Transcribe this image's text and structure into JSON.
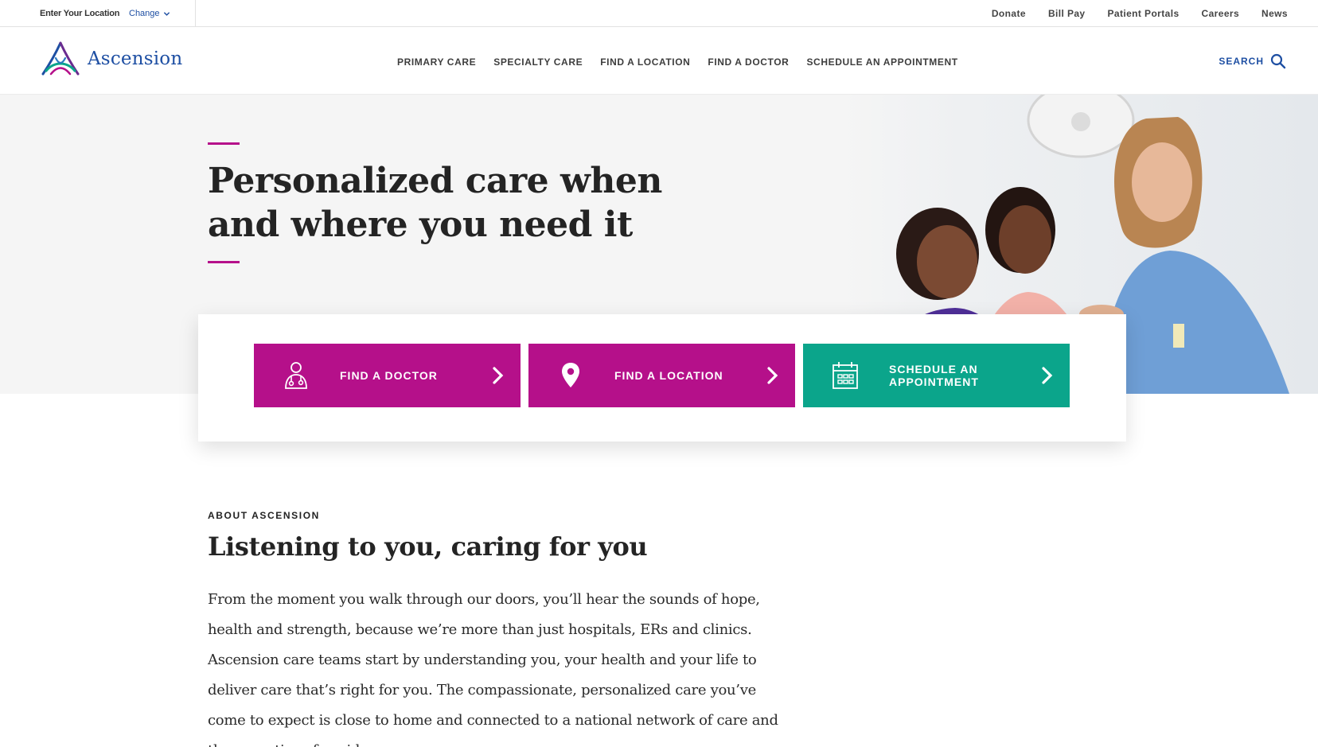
{
  "utility_bar": {
    "location_label": "Enter Your Location",
    "change_label": "Change",
    "links": [
      "Donate",
      "Bill Pay",
      "Patient Portals",
      "Careers",
      "News"
    ]
  },
  "header": {
    "brand": "Ascension",
    "nav": [
      "PRIMARY CARE",
      "SPECIALTY CARE",
      "FIND A LOCATION",
      "FIND A DOCTOR",
      "SCHEDULE AN APPOINTMENT"
    ],
    "search_label": "SEARCH"
  },
  "hero": {
    "title": "Personalized care when and where you need it"
  },
  "cta": {
    "doctor": "FIND A DOCTOR",
    "location": "FIND A LOCATION",
    "schedule_line1": "SCHEDULE AN",
    "schedule_line2": "APPOINTMENT"
  },
  "about": {
    "eyebrow": "ABOUT ASCENSION",
    "title": "Listening to you, caring for you",
    "body": "From the moment you walk through our doors, you’ll hear the sounds of hope, health and strength, because we’re more than just hospitals, ERs and clinics. Ascension care teams start by understanding you, your health and your life to deliver care that’s right for you. The compassionate, personalized care you’ve come to expect is close to home and connected to a national network of care and the expertise of a wide range"
  },
  "colors": {
    "brand_blue": "#1e4fa3",
    "accent_magenta": "#b5108a",
    "accent_teal": "#0ba58b"
  },
  "icons": [
    "chevron-down-icon",
    "ascension-logo-icon",
    "search-icon",
    "doctor-icon",
    "location-pin-icon",
    "calendar-icon",
    "chevron-right-icon"
  ]
}
